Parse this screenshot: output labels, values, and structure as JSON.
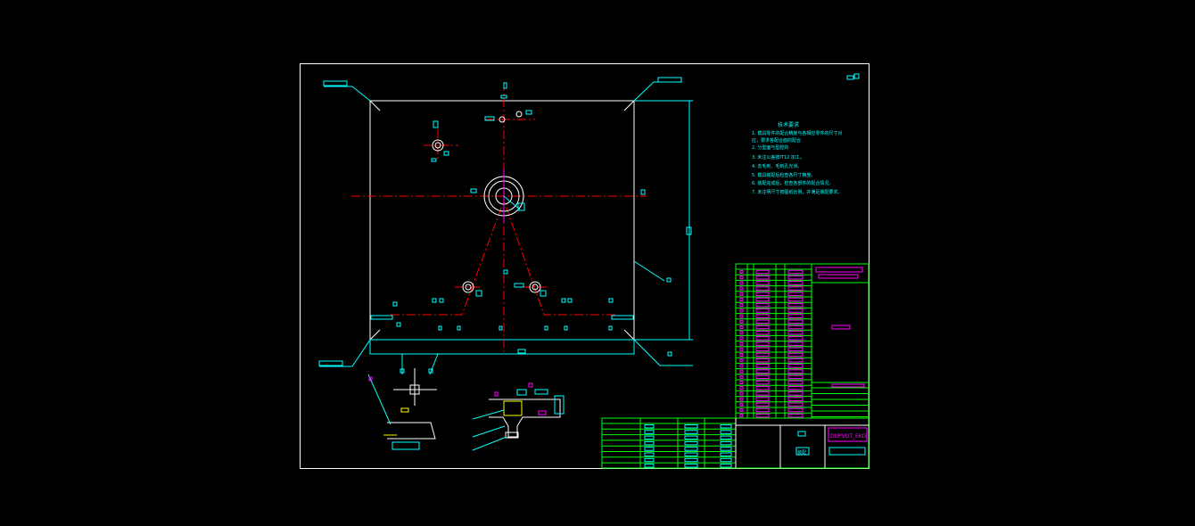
{
  "drawing": {
    "title": "技术要求",
    "tech_notes": [
      "1. 模具零件的配合精度与各相应零件的尺寸对",
      "   应，要求各配合面的配合",
      "2. 分型面与型腔的",
      "3. 未注公差按IT12 加工。",
      "4. 去毛刺、毛刺孔光滑。",
      "5. 模具装配后检查各尺寸精度。",
      "6. 装配完成后，检查各部件的配合情况。",
      "7. 未注明尺寸按图纸比例，并满足装配要求。"
    ],
    "title_block_code": "DUPVOT_EKD",
    "title_block_label": "装配",
    "colors": {
      "frame": "#ffffff",
      "centerline": "#ff0000",
      "dimension": "#00ffff",
      "table": "#00ff00",
      "annotation": "#ff00ff",
      "yellow": "#ffff00"
    }
  }
}
